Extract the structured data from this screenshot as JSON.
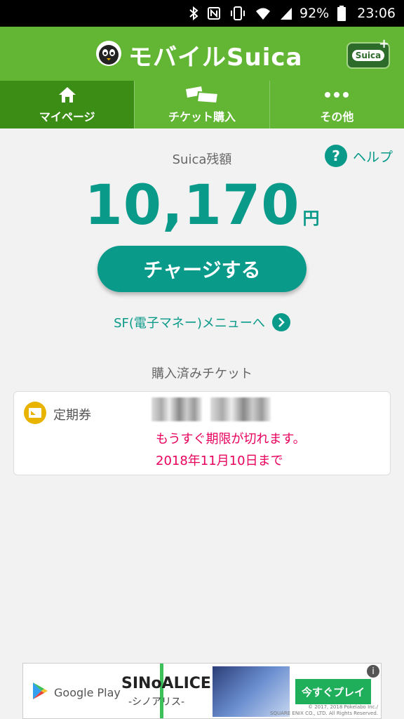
{
  "status_bar": {
    "battery": "92%",
    "time": "23:06",
    "icons": [
      "bluetooth-icon",
      "nfc-icon",
      "vibrate-icon",
      "wifi-icon",
      "signal-icon",
      "battery-icon"
    ]
  },
  "header": {
    "app_title": "モバイルSuica",
    "card_label": "Suica",
    "card_plus": "+"
  },
  "tabs": [
    {
      "label": "マイページ",
      "icon": "home-icon",
      "active": true
    },
    {
      "label": "チケット購入",
      "icon": "tickets-icon",
      "active": false
    },
    {
      "label": "その他",
      "icon": "more-icon",
      "active": false
    }
  ],
  "balance": {
    "label": "Suica残額",
    "amount": "10,170",
    "unit": "円"
  },
  "help": {
    "label": "ヘルプ",
    "icon_glyph": "?"
  },
  "charge_button": "チャージする",
  "sf_menu_link": "SF(電子マネー)メニューへ",
  "tickets": {
    "title": "購入済みチケット",
    "items": [
      {
        "type": "定期券",
        "warning_line1": "もうすぐ期限が切れます。",
        "warning_line2": "2018年11月10日まで"
      }
    ]
  },
  "ad": {
    "store": "Google Play",
    "title": "SINoALICE",
    "subtitle": "-シノアリス-",
    "cta": "今すぐプレイ",
    "info_glyph": "i",
    "copyright_line1": "© 2017, 2018 Pokelabo Inc./",
    "copyright_line2": "SQUARE ENIX CO., LTD. All Rights Reserved."
  },
  "colors": {
    "header_green": "#63b534",
    "active_tab": "#3c8d16",
    "accent_teal": "#0a9a8a",
    "warning_pink": "#e8005c",
    "ticket_icon_yellow": "#e8b400"
  }
}
